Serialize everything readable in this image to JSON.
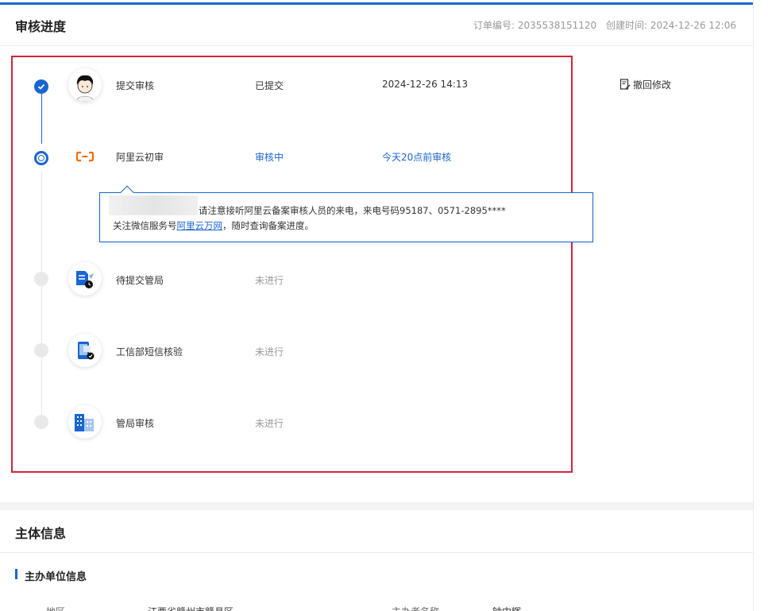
{
  "header": {
    "title": "审核进度",
    "order_no": "订单编号: 2035538151120",
    "created_at": "创建时间: 2024-12-26 12:06"
  },
  "steps": [
    {
      "label": "提交审核",
      "status": "已提交",
      "time": "2024-12-26 14:13",
      "state": "done",
      "icon": "person-avatar-icon"
    },
    {
      "label": "阿里云初审",
      "status": "审核中",
      "time": "今天20点前审核",
      "state": "active",
      "icon": "aliyun-logo-icon"
    },
    {
      "label": "待提交管局",
      "status": "未进行",
      "time": "",
      "state": "pending",
      "icon": "document-clock-icon"
    },
    {
      "label": "工信部短信核验",
      "status": "未进行",
      "time": "",
      "state": "pending",
      "icon": "phone-check-icon"
    },
    {
      "label": "管局审核",
      "status": "未进行",
      "time": "",
      "state": "pending",
      "icon": "building-icon"
    }
  ],
  "revoke": {
    "label": "撤回修改",
    "icon": "document-edit-icon"
  },
  "tip": {
    "line1": "请注意接听阿里云备案审核人员的来电，来电号码95187、0571-2895****",
    "line2_prefix": "关注微信服务号",
    "line2_link": "阿里云万网",
    "line2_suffix": "，随时查询备案进度。"
  },
  "section2": {
    "title": "主体信息",
    "subtitle": "主办单位信息",
    "row": [
      "地区",
      "江西省赣州市赣县区",
      "主办者名称",
      "钟中辉"
    ]
  },
  "colors": {
    "accent": "#1966d2",
    "highlight_border": "#d9233a",
    "aliyun_orange": "#ff6a00"
  }
}
